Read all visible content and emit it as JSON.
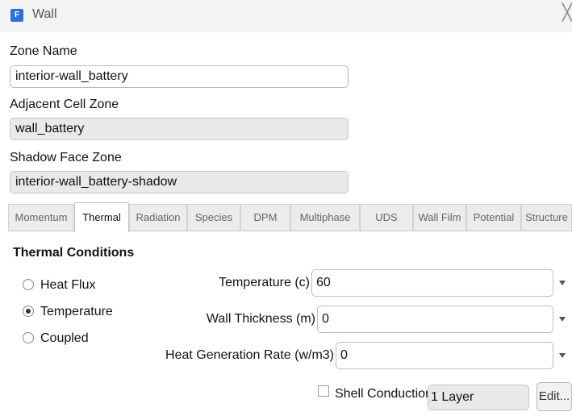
{
  "window": {
    "app_icon_letter": "F",
    "title": "Wall",
    "close_glyph": "╳"
  },
  "zone_name": {
    "label": "Zone Name",
    "value": "interior-wall_battery"
  },
  "adjacent_cell_zone": {
    "label": "Adjacent Cell Zone",
    "value": "wall_battery"
  },
  "shadow_face_zone": {
    "label": "Shadow Face Zone",
    "value": "interior-wall_battery-shadow"
  },
  "tabs": [
    {
      "label": "Momentum"
    },
    {
      "label": "Thermal"
    },
    {
      "label": "Radiation"
    },
    {
      "label": "Species"
    },
    {
      "label": "DPM"
    },
    {
      "label": "Multiphase"
    },
    {
      "label": "UDS"
    },
    {
      "label": "Wall Film"
    },
    {
      "label": "Potential"
    },
    {
      "label": "Structure"
    }
  ],
  "active_tab": "Thermal",
  "thermal": {
    "section_title": "Thermal Conditions",
    "conditions": [
      {
        "label": "Heat Flux",
        "checked": false
      },
      {
        "label": "Temperature",
        "checked": true
      },
      {
        "label": "Coupled",
        "checked": false
      }
    ],
    "params": [
      {
        "label": "Temperature (c)",
        "value": "60"
      },
      {
        "label": "Wall Thickness (m)",
        "value": "0"
      },
      {
        "label": "Heat Generation Rate (w/m3)",
        "value": "0"
      }
    ],
    "shell_conduction": {
      "label": "Shell Conduction",
      "checked": false
    },
    "layers": "1 Layer",
    "edit_label": "Edit..."
  },
  "icons": {
    "dropdown": "chevron-down-icon",
    "app": "fluent-app-icon",
    "close": "close-icon"
  }
}
